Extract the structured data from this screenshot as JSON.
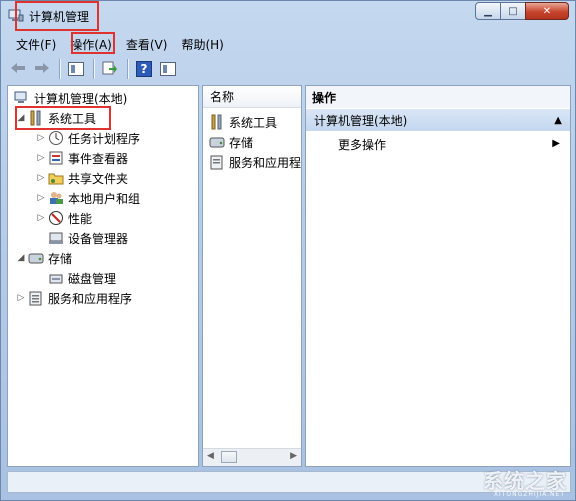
{
  "window": {
    "title": "计算机管理",
    "caption": {
      "minimize": "▁",
      "maximize": "□",
      "close": "✕"
    }
  },
  "menu": [
    "文件(F)",
    "操作(A)",
    "查看(V)",
    "帮助(H)"
  ],
  "toolbar": {
    "back": "back-icon",
    "forward": "forward-icon",
    "show_hide": "console-tree-icon",
    "export": "export-icon",
    "help": "?",
    "panel": "panel-icon"
  },
  "tree": {
    "root": "计算机管理(本地)",
    "system_tools": "系统工具",
    "task_scheduler": "任务计划程序",
    "event_viewer": "事件查看器",
    "shared_folders": "共享文件夹",
    "local_users": "本地用户和组",
    "performance": "性能",
    "device_manager": "设备管理器",
    "storage": "存储",
    "disk_management": "磁盘管理",
    "services_apps": "服务和应用程序"
  },
  "list": {
    "header": "名称",
    "items": [
      "系统工具",
      "存储",
      "服务和应用程"
    ]
  },
  "actions": {
    "header": "操作",
    "section": "计算机管理(本地)",
    "more": "更多操作"
  },
  "watermark": {
    "text": "系统之家",
    "sub": "XITONGZHIJIA.NET"
  },
  "colors": {
    "highlight_box": "#e0322e",
    "accent": "#c4d7ef"
  }
}
